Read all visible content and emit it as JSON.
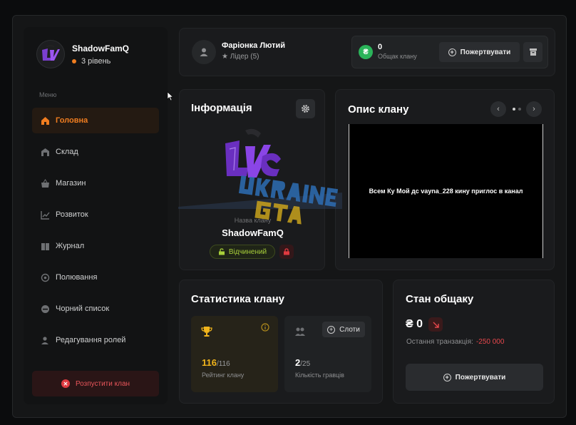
{
  "sidebar": {
    "profile": {
      "name": "ShadowFamQ",
      "level": "3 рівень",
      "level_dot_color": "#f07d20"
    },
    "menu_caption": "Меню",
    "items": [
      {
        "label": "Головна",
        "icon": "home-icon",
        "active": true
      },
      {
        "label": "Склад",
        "icon": "warehouse-icon"
      },
      {
        "label": "Магазин",
        "icon": "shop-icon"
      },
      {
        "label": "Розвиток",
        "icon": "chart-icon"
      },
      {
        "label": "Журнал",
        "icon": "book-icon"
      },
      {
        "label": "Полювання",
        "icon": "target-icon"
      },
      {
        "label": "Чорний список",
        "icon": "blacklist-icon"
      },
      {
        "label": "Редагування ролей",
        "icon": "roles-icon"
      }
    ],
    "disband_label": "Розпустити клан"
  },
  "topbar": {
    "leader_name": "Фаріонка Лютий",
    "leader_role": "Лідер (5)",
    "fund_value": "0",
    "fund_label": "Общак клану",
    "donate_label": "Пожертвувати"
  },
  "info": {
    "title": "Інформація",
    "name_caption": "Назва клану",
    "clan_name": "ShadowFamQ",
    "status": "Відчинений"
  },
  "description": {
    "title": "Опис клану",
    "text": "Всем Ку  Мой дс vayna_228 кину приглос в канал"
  },
  "stats": {
    "title": "Статистика клану",
    "rating_value": "116",
    "rating_max": "/116",
    "rating_label": "Рейтинг клану",
    "players_value": "2",
    "players_max": "/25",
    "players_label": "Кількість гравців",
    "slots_label": "Слоти"
  },
  "fund_state": {
    "title": "Стан общаку",
    "balance": "₴ 0",
    "last_tx_label": "Остання транзакція:",
    "last_tx_value": "-250 000",
    "donate_label": "Пожертвувати"
  },
  "colors": {
    "accent": "#f07d20",
    "success": "#2bb45a",
    "danger": "#e6474c",
    "status_open": "#a8cf3a"
  }
}
